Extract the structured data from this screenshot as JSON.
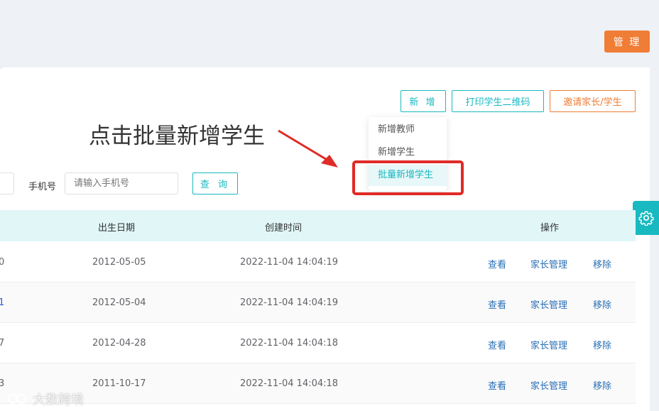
{
  "header": {
    "manage_label": "管 理"
  },
  "toolbar": {
    "new_label": "新 增",
    "print_qr_label": "打印学生二维码",
    "invite_label": "邀请家长/学生"
  },
  "dropdown": {
    "items": [
      {
        "label": "新增教师"
      },
      {
        "label": "新增学生"
      },
      {
        "label": "批量新增学生"
      }
    ],
    "active_index": 2
  },
  "annotation": {
    "text": "点击批量新增学生"
  },
  "filters": {
    "phone_label": "手机号",
    "phone_placeholder": "请输入手机号",
    "query_label": "查 询"
  },
  "table": {
    "headers": {
      "birth": "出生日期",
      "created": "创建时间",
      "actions": "操作"
    },
    "rows": [
      {
        "id": "0",
        "birth": "2012-05-05",
        "created": "2022-11-04 14:04:19"
      },
      {
        "id": "1",
        "birth": "2012-05-04",
        "created": "2022-11-04 14:04:19"
      },
      {
        "id": "7",
        "birth": "2012-04-28",
        "created": "2022-11-04 14:04:18"
      },
      {
        "id": "3",
        "birth": "2011-10-17",
        "created": "2022-11-04 14:04:18"
      }
    ],
    "action_labels": {
      "view": "查看",
      "parent": "家长管理",
      "remove": "移除"
    }
  },
  "watermark": {
    "text": "大数跨境"
  },
  "colors": {
    "accent": "#18b9c0",
    "orange": "#f07d35",
    "highlight": "#e02b26",
    "link": "#2a6fb5"
  }
}
